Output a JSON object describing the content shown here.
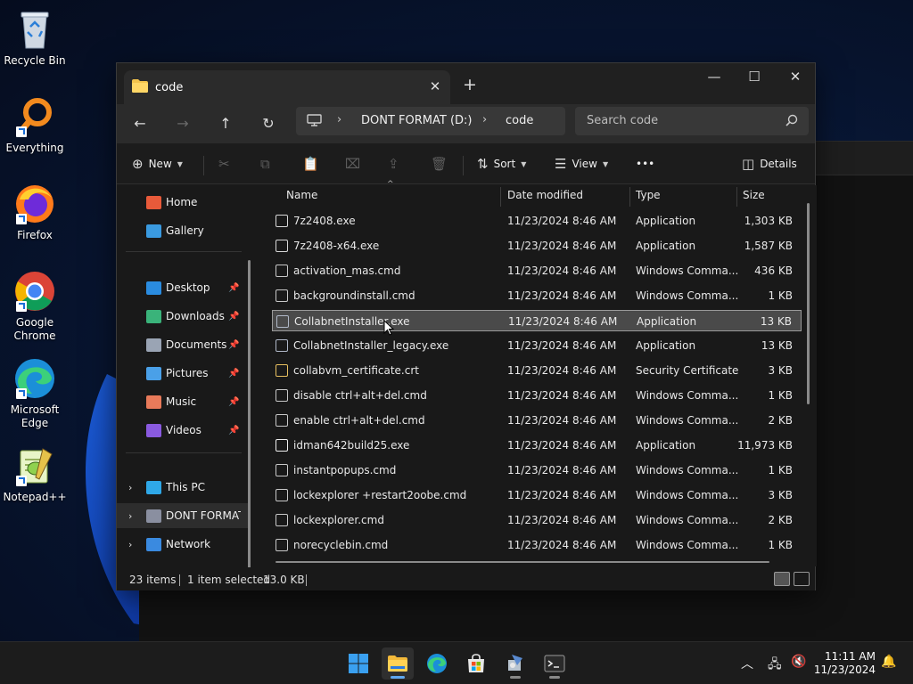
{
  "desktop_icons": [
    {
      "label": "Recycle Bin",
      "icon": "recycle-bin-icon"
    },
    {
      "label": "Everything",
      "icon": "everything-search-icon"
    },
    {
      "label": "Firefox",
      "icon": "firefox-icon"
    },
    {
      "label": "Google Chrome",
      "icon": "chrome-icon"
    },
    {
      "label": "Microsoft Edge",
      "icon": "edge-icon"
    },
    {
      "label": "Notepad++",
      "icon": "notepadpp-icon"
    }
  ],
  "window": {
    "tab_title": "code",
    "new_tab": "+",
    "minimize": "—",
    "maximize": "☐",
    "close": "✕"
  },
  "address": {
    "drive": "DONT FORMAT (D:)",
    "folder": "code",
    "search_placeholder": "Search code"
  },
  "commands": {
    "new": "New",
    "sort": "Sort",
    "view": "View",
    "more": "•••",
    "details": "Details"
  },
  "nav": {
    "home": "Home",
    "gallery": "Gallery",
    "quick": [
      {
        "label": "Desktop",
        "color": "#2a8ce0"
      },
      {
        "label": "Downloads",
        "color": "#3ab37a"
      },
      {
        "label": "Documents",
        "color": "#9aa4b4"
      },
      {
        "label": "Pictures",
        "color": "#4aa0e8"
      },
      {
        "label": "Music",
        "color": "#e87a5a"
      },
      {
        "label": "Videos",
        "color": "#8a5ae0"
      }
    ],
    "this_pc": "This PC",
    "drive": "DONT FORMAT (D:)",
    "network": "Network"
  },
  "columns": {
    "name": "Name",
    "date": "Date modified",
    "type": "Type",
    "size": "Size"
  },
  "files": [
    {
      "name": "7z2408.exe",
      "date": "11/23/2024 8:46 AM",
      "type": "Application",
      "size": "1,303 KB",
      "icon": "7z-icon"
    },
    {
      "name": "7z2408-x64.exe",
      "date": "11/23/2024 8:46 AM",
      "type": "Application",
      "size": "1,587 KB",
      "icon": "7z-icon"
    },
    {
      "name": "activation_mas.cmd",
      "date": "11/23/2024 8:46 AM",
      "type": "Windows Comma...",
      "size": "436 KB",
      "icon": "cmd-icon"
    },
    {
      "name": "backgroundinstall.cmd",
      "date": "11/23/2024 8:46 AM",
      "type": "Windows Comma...",
      "size": "1 KB",
      "icon": "cmd-icon"
    },
    {
      "name": "CollabnetInstaller.exe",
      "date": "11/23/2024 8:46 AM",
      "type": "Application",
      "size": "13 KB",
      "icon": "exe-icon"
    },
    {
      "name": "CollabnetInstaller_legacy.exe",
      "date": "11/23/2024 8:46 AM",
      "type": "Application",
      "size": "13 KB",
      "icon": "exe-icon"
    },
    {
      "name": "collabvm_certificate.crt",
      "date": "11/23/2024 8:46 AM",
      "type": "Security Certificate",
      "size": "3 KB",
      "icon": "cert-icon"
    },
    {
      "name": "disable ctrl+alt+del.cmd",
      "date": "11/23/2024 8:46 AM",
      "type": "Windows Comma...",
      "size": "1 KB",
      "icon": "cmd-icon"
    },
    {
      "name": "enable ctrl+alt+del.cmd",
      "date": "11/23/2024 8:46 AM",
      "type": "Windows Comma...",
      "size": "2 KB",
      "icon": "cmd-icon"
    },
    {
      "name": "idman642build25.exe",
      "date": "11/23/2024 8:46 AM",
      "type": "Application",
      "size": "11,973 KB",
      "icon": "file-icon"
    },
    {
      "name": "instantpopups.cmd",
      "date": "11/23/2024 8:46 AM",
      "type": "Windows Comma...",
      "size": "1 KB",
      "icon": "cmd-icon"
    },
    {
      "name": "lockexplorer +restart2oobe.cmd",
      "date": "11/23/2024 8:46 AM",
      "type": "Windows Comma...",
      "size": "3 KB",
      "icon": "cmd-icon"
    },
    {
      "name": "lockexplorer.cmd",
      "date": "11/23/2024 8:46 AM",
      "type": "Windows Comma...",
      "size": "2 KB",
      "icon": "cmd-icon"
    },
    {
      "name": "norecyclebin.cmd",
      "date": "11/23/2024 8:46 AM",
      "type": "Windows Comma...",
      "size": "1 KB",
      "icon": "cmd-icon"
    }
  ],
  "selected_index": 4,
  "status": {
    "count": "23 items",
    "selection": "1 item selected",
    "size": "13.0 KB"
  },
  "clock": {
    "time": "11:11 AM",
    "date": "11/23/2024"
  }
}
